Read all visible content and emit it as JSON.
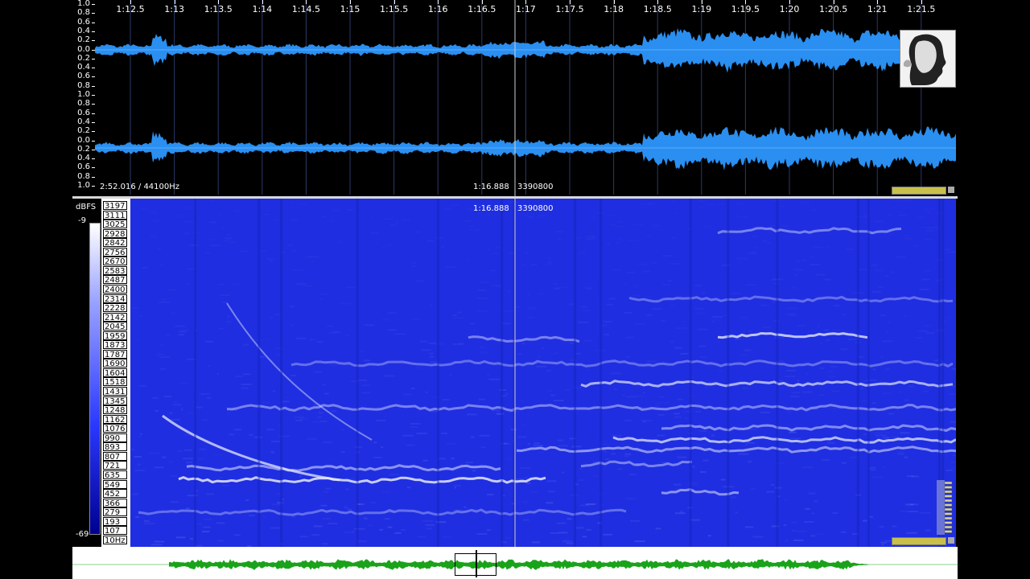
{
  "waveform": {
    "scale_labels": [
      "1.0",
      "0.8",
      "0.6",
      "0.4",
      "0.2",
      "0.0",
      "0.2",
      "0.4",
      "0.6",
      "0.8",
      "1.0",
      "0.8",
      "0.6",
      "0.4",
      "0.2",
      "0.0",
      "0.2",
      "0.4",
      "0.6",
      "0.8",
      "1.0"
    ],
    "timeline_labels": [
      "1:12.5",
      "1:13",
      "1:13.5",
      "1:14",
      "1:14.5",
      "1:15",
      "1:15.5",
      "1:16",
      "1:16.5",
      "1:17",
      "1:17.5",
      "1:18",
      "1:18.5",
      "1:19",
      "1:19.5",
      "1:20",
      "1:20.5",
      "1:21",
      "1:21.5"
    ],
    "file_info": "2:52.016 / 44100Hz",
    "cursor_time": "1:16.888",
    "cursor_sample": "3390800",
    "level_fill_percent": 100,
    "waveform_color": "#2a8ff0"
  },
  "spectrogram": {
    "unit_label": "dBFS",
    "db_top": "-9",
    "db_bottom": "-69",
    "freq_labels": [
      "3197",
      "3111",
      "3025",
      "2928",
      "2842",
      "2756",
      "2670",
      "2583",
      "2487",
      "2400",
      "2314",
      "2228",
      "2142",
      "2045",
      "1959",
      "1873",
      "1787",
      "1690",
      "1604",
      "1518",
      "1431",
      "1345",
      "1248",
      "1162",
      "1076",
      "990",
      "893",
      "807",
      "721",
      "635",
      "549",
      "452",
      "366",
      "279",
      "193",
      "107",
      "10Hz"
    ],
    "cursor_time": "1:16.888",
    "cursor_sample": "3390800",
    "level_fill_percent": 100,
    "background_color": "#1f2ee0"
  },
  "overview": {
    "waveform_color": "#1aa31a"
  }
}
